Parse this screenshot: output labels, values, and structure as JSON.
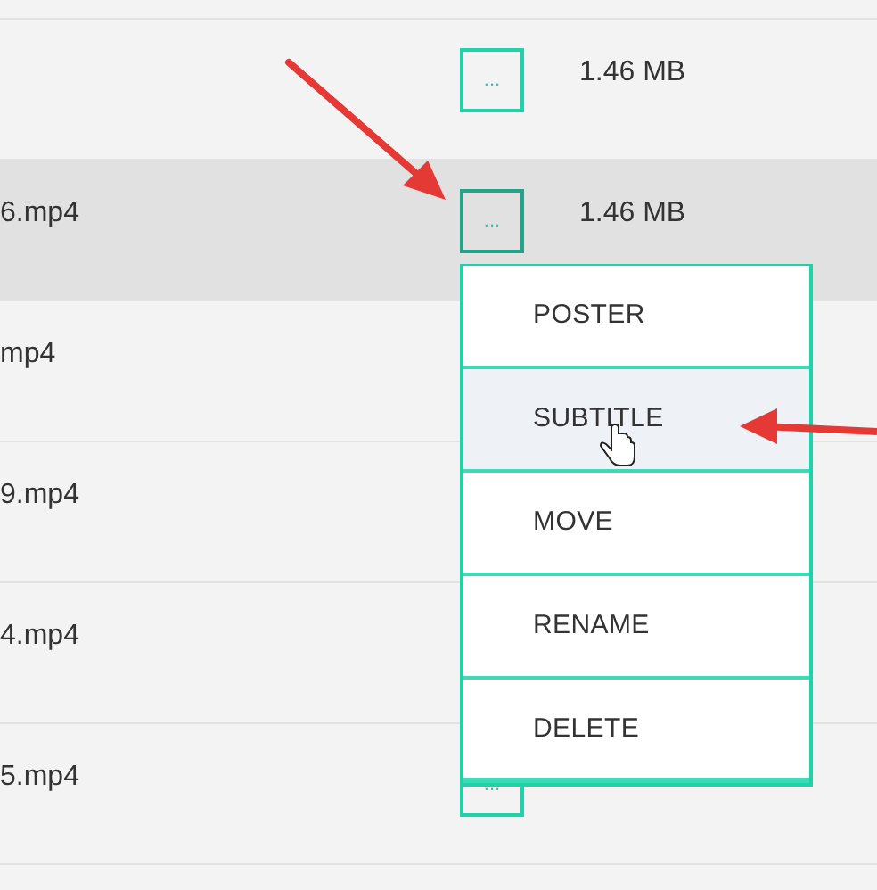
{
  "rows": [
    {
      "size": "1.46 MB",
      "menu_button": "...",
      "selected": false
    },
    {
      "name": "6.mp4",
      "size": "1.46 MB",
      "menu_button": "...",
      "selected": true
    },
    {
      "name": "mp4",
      "selected": false
    },
    {
      "name": "9.mp4",
      "selected": false
    },
    {
      "name": "4.mp4",
      "selected": false
    },
    {
      "name": "5.mp4",
      "menu_button": "...",
      "selected": false
    },
    {
      "selected": false
    }
  ],
  "menu": {
    "items": [
      {
        "label": "POSTER",
        "selected": false
      },
      {
        "label": "SUBTITLE",
        "selected": true
      },
      {
        "label": "MOVE",
        "selected": false
      },
      {
        "label": "RENAME",
        "selected": false
      },
      {
        "label": "DELETE",
        "selected": false
      }
    ]
  }
}
